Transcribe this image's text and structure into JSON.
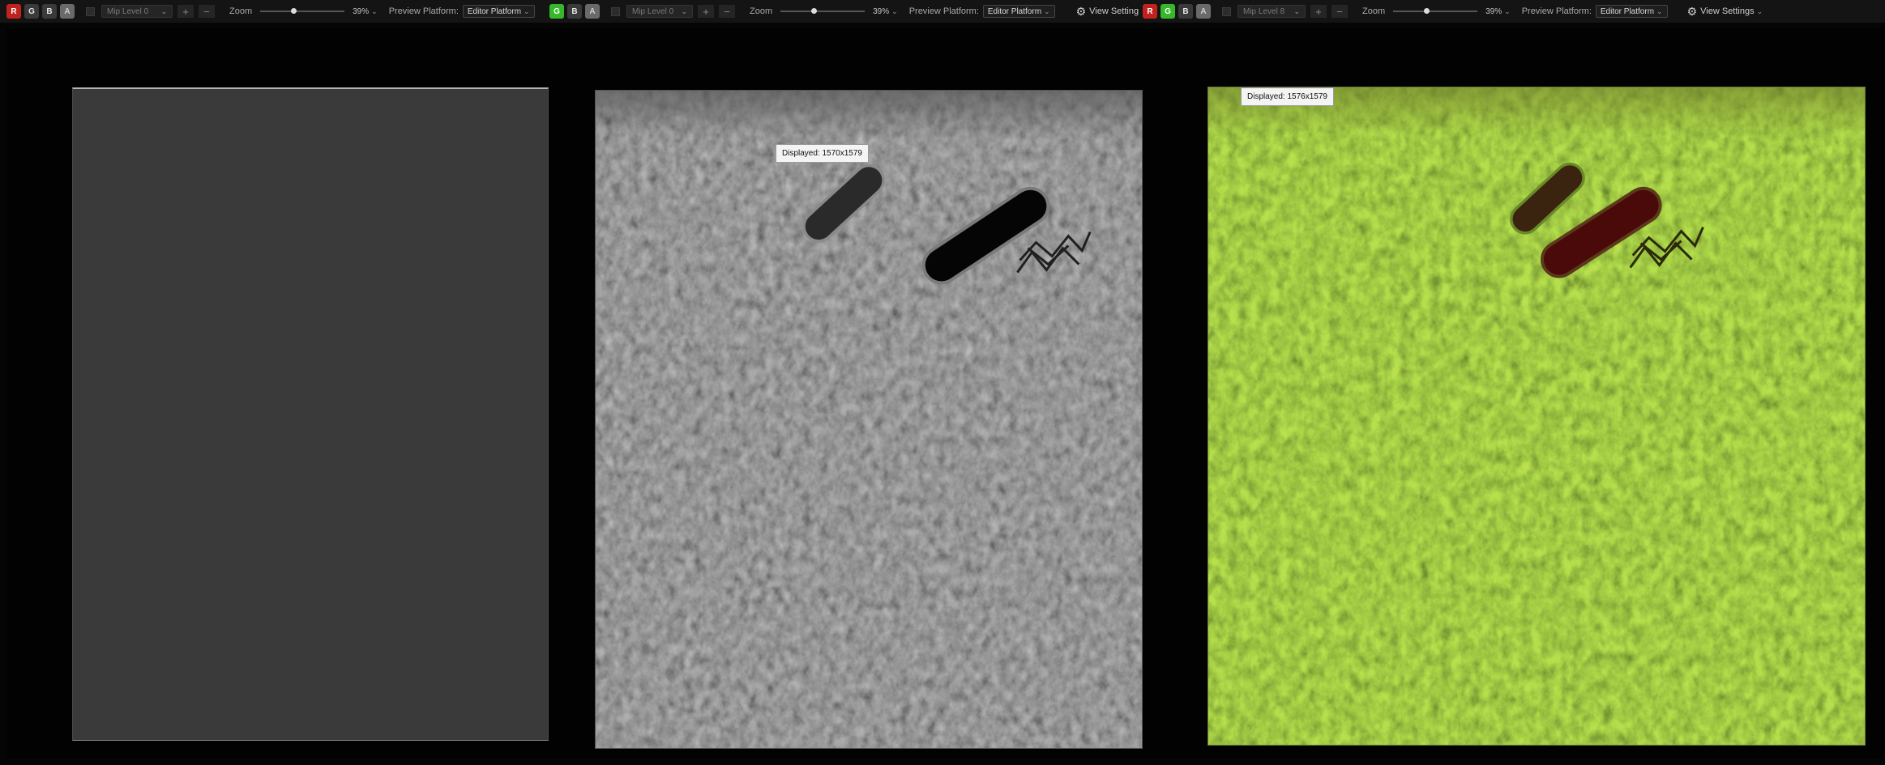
{
  "viewers": [
    {
      "channels": [
        "R",
        "G",
        "B",
        "A"
      ],
      "mip_level": "Mip Level 0",
      "zoom_label": "Zoom",
      "zoom_value": "39%",
      "zoom_fraction": 0.39,
      "preview_platform_label": "Preview Platform:",
      "preview_platform_value": "Editor Platform"
    },
    {
      "channels": [
        "G",
        "B",
        "A"
      ],
      "mip_level": "Mip Level 0",
      "zoom_label": "Zoom",
      "zoom_value": "39%",
      "zoom_fraction": 0.39,
      "preview_platform_label": "Preview Platform:",
      "preview_platform_value": "Editor Platform",
      "view_settings_label": "View Setting",
      "displayed_tooltip": "Displayed: 1570x1579"
    },
    {
      "channels": [
        "R",
        "G",
        "B",
        "A"
      ],
      "mip_level": "Mip Level 8",
      "zoom_label": "Zoom",
      "zoom_value": "39%",
      "zoom_fraction": 0.39,
      "preview_platform_label": "Preview Platform:",
      "preview_platform_value": "Editor Platform",
      "view_settings_label": "View Settings",
      "displayed_tooltip": "Displayed: 1576x1579"
    }
  ],
  "icons": {
    "gear": "gear-icon",
    "plus": "plus-icon",
    "minus": "minus-icon",
    "chevron": "chevron-down-icon"
  },
  "colors": {
    "red_channel_active": "#c0221e",
    "green_channel_active": "#36b82a",
    "panel_flat_gray": "#3a3a3a",
    "panel_green_tint": "#465a1a",
    "panel_red_mark": "#4a0a0a"
  }
}
